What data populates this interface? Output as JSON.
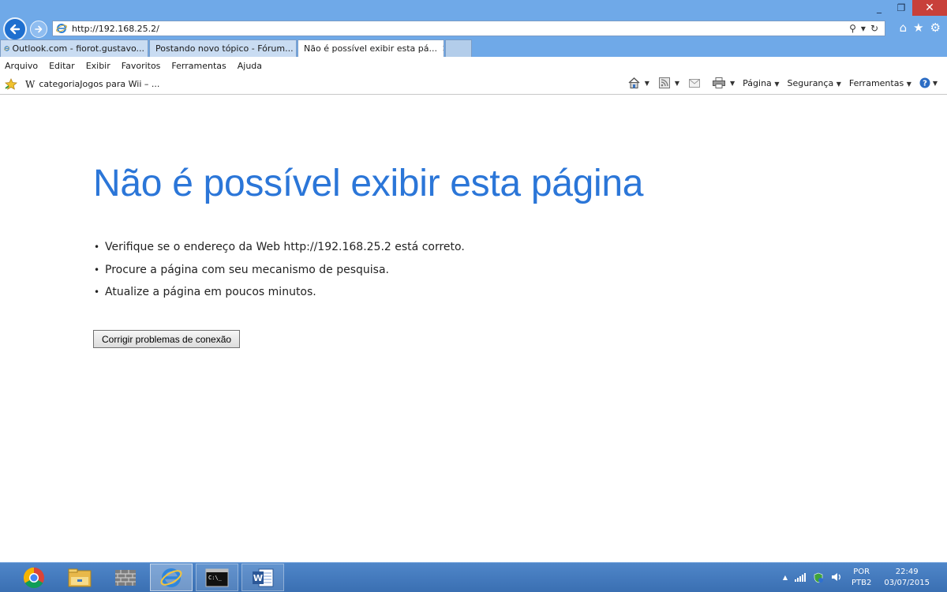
{
  "window": {
    "controls": {
      "minimize_glyph": "_",
      "restore_glyph": "❐",
      "close_glyph": "✕"
    }
  },
  "address_bar": {
    "url": "http://192.168.25.2/",
    "search_glyph": "⚲",
    "dropdown_glyph": "▾",
    "refresh_glyph": "↻"
  },
  "toolbar_right": {
    "home_glyph": "⌂",
    "favorites_glyph": "★",
    "tools_glyph": "⚙"
  },
  "tabs": [
    {
      "label": "Outlook.com - fiorot.gustavo...",
      "icon": "ie-icon",
      "active": false
    },
    {
      "label": "Postando novo tópico - Fórum...",
      "icon": "forum-icon",
      "active": false
    },
    {
      "label": "Não é possível exibir esta pá...",
      "icon": "ie-icon",
      "active": true,
      "close_glyph": "✕"
    }
  ],
  "menu": {
    "items": [
      "Arquivo",
      "Editar",
      "Exibir",
      "Favoritos",
      "Ferramentas",
      "Ajuda"
    ]
  },
  "favorites_bar": {
    "item_glyph": "W",
    "item_label": "categoriaJogos para Wii – ..."
  },
  "command_bar": {
    "page_label": "Página",
    "security_label": "Segurança",
    "tools_label": "Ferramentas",
    "arrow_glyph": "▼"
  },
  "error_page": {
    "title": "Não é possível exibir esta página",
    "bullet_glyph": "•",
    "suggestions": [
      "Verifique se o endereço da Web http://192.168.25.2 está correto.",
      "Procure a página com seu mecanismo de pesquisa.",
      "Atualize a página em poucos minutos."
    ],
    "fix_button_label": "Corrigir problemas de conexão",
    "title_color": "#2b76d8"
  },
  "taskbar": {
    "apps": [
      "chrome-icon",
      "file-explorer-icon",
      "firewall-icon",
      "internet-explorer-icon",
      "command-prompt-icon",
      "word-icon"
    ],
    "tray": {
      "overflow_glyph": "▲",
      "language_top": "POR",
      "language_bottom": "PTB2",
      "time": "22:49",
      "date": "03/07/2015"
    }
  }
}
